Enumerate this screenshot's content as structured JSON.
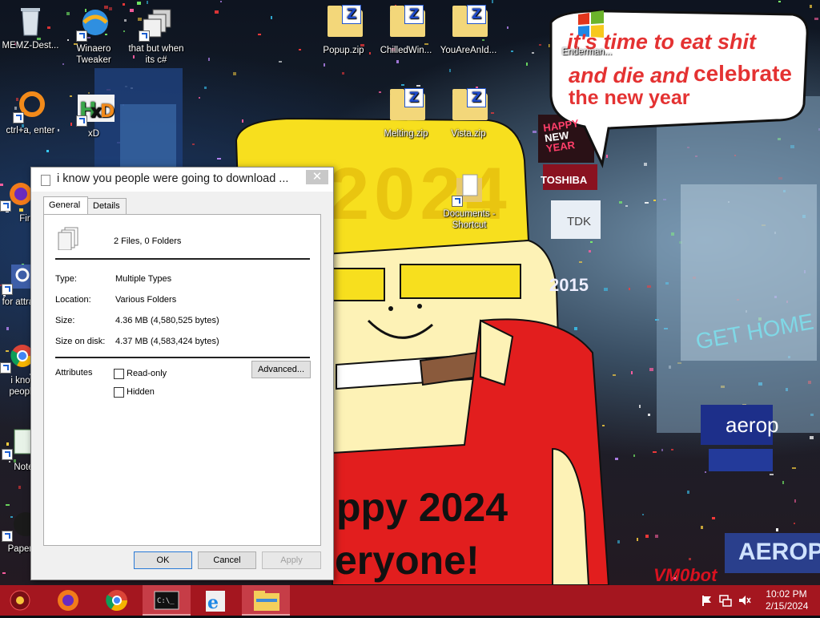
{
  "desktop": {
    "icons": [
      {
        "label": "MEMZ-Dest..."
      },
      {
        "label": "Winaero Tweaker"
      },
      {
        "label": "that but when its c#"
      },
      {
        "label": "Popup.zip"
      },
      {
        "label": "ChilledWin..."
      },
      {
        "label": "YouAreAnId..."
      },
      {
        "label": "Enderman..."
      },
      {
        "label": "ctrl+a, enter"
      },
      {
        "label": "xD"
      },
      {
        "label": "Melting.zip"
      },
      {
        "label": "Vista.zip"
      },
      {
        "label": "Fire"
      },
      {
        "label": "Documents - Shortcut"
      },
      {
        "label": "for attrac"
      },
      {
        "label": "i know people"
      },
      {
        "label": "Notep"
      },
      {
        "label": "Papers"
      }
    ],
    "zip_badge": "Z",
    "wallpaper": {
      "bubble_line1": "it's time to eat shit",
      "bubble_line2a": "and die and",
      "bubble_line2b": "celebrate",
      "bubble_line3": "the new year",
      "hat_text": "2024",
      "shirt_line1": "ppy 2024",
      "shirt_line2": "eryone!",
      "sign_happy": "HAPPY",
      "sign_new": "NEW",
      "sign_year": "YEAR",
      "sign_toshiba": "TOSHIBA",
      "sign_tdk": "TDK",
      "sign_2015": "2015",
      "sign_gethome": "GET HOME",
      "sign_aero": "aerop",
      "sign_aeropos": "AEROPOS",
      "watermark": "VM0bot"
    }
  },
  "properties_window": {
    "title": "i know you people were going to download ...",
    "close_glyph": "✕",
    "tabs": [
      {
        "label": "General"
      },
      {
        "label": "Details"
      }
    ],
    "summary": "2 Files, 0 Folders",
    "fields": [
      {
        "label": "Type:",
        "value": "Multiple Types"
      },
      {
        "label": "Location:",
        "value": "Various Folders"
      },
      {
        "label": "Size:",
        "value": "4.36 MB (4,580,525 bytes)"
      },
      {
        "label": "Size on disk:",
        "value": "4.37 MB (4,583,424 bytes)"
      }
    ],
    "attributes_label": "Attributes",
    "readonly_label": "Read-only",
    "hidden_label": "Hidden",
    "readonly_checked": false,
    "hidden_checked": false,
    "advanced_label": "Advanced...",
    "ok_label": "OK",
    "cancel_label": "Cancel",
    "apply_label": "Apply"
  },
  "taskbar": {
    "color": "#a4161f",
    "apps": [
      {
        "icon": "start-orb-icon"
      },
      {
        "icon": "firefox-icon"
      },
      {
        "icon": "chrome-icon"
      },
      {
        "icon": "command-prompt-icon"
      },
      {
        "icon": "internet-explorer-icon"
      },
      {
        "icon": "file-explorer-icon"
      }
    ],
    "time": "10:02 PM",
    "date": "2/15/2024"
  }
}
